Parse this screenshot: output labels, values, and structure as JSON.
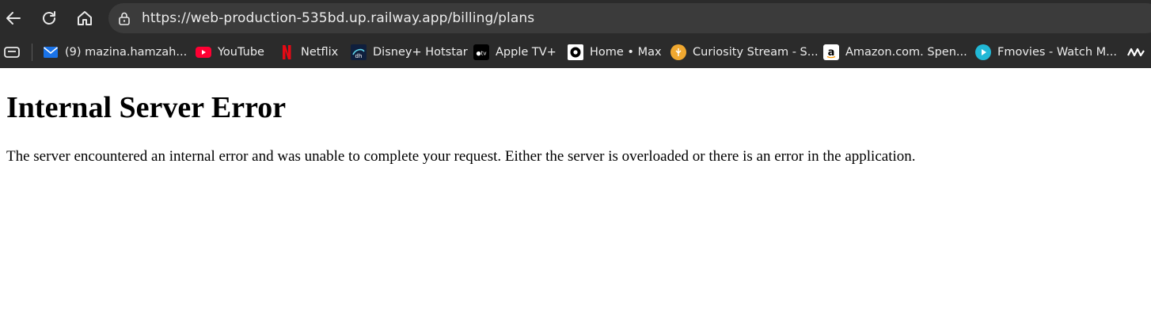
{
  "browser": {
    "url": "https://web-production-535bd.up.railway.app/billing/plans",
    "bookmarks": [
      {
        "label": "(9) mazina.hamzah...",
        "icon": "mail-icon"
      },
      {
        "label": "YouTube",
        "icon": "youtube-icon"
      },
      {
        "label": "Netflix",
        "icon": "netflix-icon"
      },
      {
        "label": "Disney+ Hotstar",
        "icon": "hotstar-icon"
      },
      {
        "label": "Apple TV+",
        "icon": "appletv-icon"
      },
      {
        "label": "Home • Max",
        "icon": "max-icon"
      },
      {
        "label": "Curiosity Stream - S...",
        "icon": "curiosity-icon"
      },
      {
        "label": "Amazon.com. Spen...",
        "icon": "amazon-icon"
      },
      {
        "label": "Fmovies - Watch M...",
        "icon": "fmovies-icon"
      }
    ],
    "colors": {
      "chrome": "#2b2b2b",
      "address_bar": "#3b3b3b",
      "text": "#ececec"
    }
  },
  "page": {
    "heading": "Internal Server Error",
    "message": "The server encountered an internal error and was unable to complete your request. Either the server is overloaded or there is an error in the application."
  }
}
